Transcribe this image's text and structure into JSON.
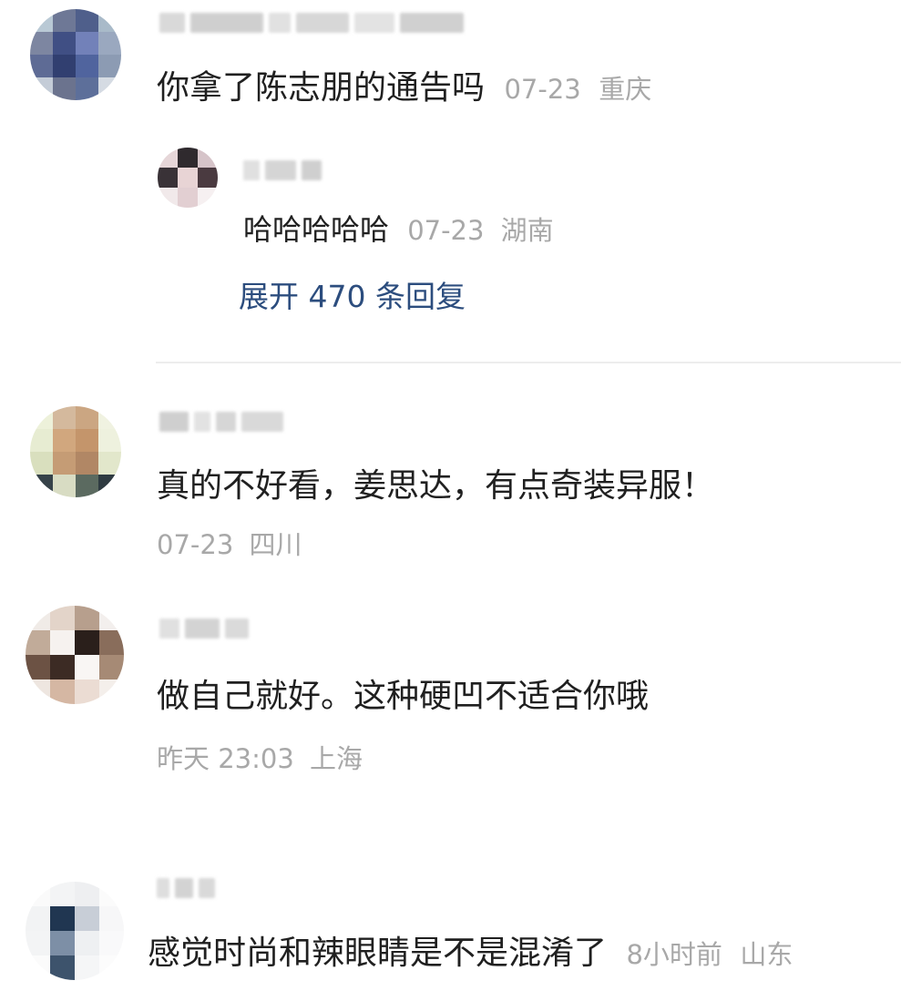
{
  "comments": [
    {
      "content": "你拿了陈志朋的通告吗",
      "date": "07-23",
      "location": "重庆",
      "replies": [
        {
          "content": "哈哈哈哈哈",
          "date": "07-23",
          "location": "湖南"
        }
      ],
      "expand_label": "展开 470 条回复"
    },
    {
      "content": "真的不好看，姜思达，有点奇装异服！",
      "date": "07-23",
      "location": "四川"
    },
    {
      "content": "做自己就好。这种硬凹不适合你哦",
      "date": "昨天 23:03",
      "location": "上海"
    },
    {
      "content": "感觉时尚和辣眼睛是不是混淆了",
      "date": "8小时前",
      "location": "山东"
    }
  ]
}
